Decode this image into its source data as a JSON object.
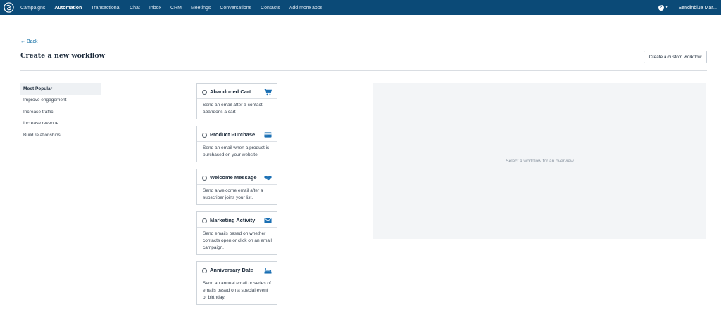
{
  "nav": {
    "items": [
      {
        "label": "Campaigns",
        "active": false
      },
      {
        "label": "Automation",
        "active": true
      },
      {
        "label": "Transactional",
        "active": false
      },
      {
        "label": "Chat",
        "active": false
      },
      {
        "label": "Inbox",
        "active": false
      },
      {
        "label": "CRM",
        "active": false
      },
      {
        "label": "Meetings",
        "active": false
      },
      {
        "label": "Conversations",
        "active": false
      },
      {
        "label": "Contacts",
        "active": false
      },
      {
        "label": "Add more apps",
        "active": false
      }
    ],
    "account_label": "Sendinblue Mar...",
    "help_icon": "question-circle-icon"
  },
  "header": {
    "back_label": "← Back",
    "title": "Create a new workflow",
    "custom_button_label": "Create a custom workflow"
  },
  "categories": [
    {
      "label": "Most Popular",
      "active": true
    },
    {
      "label": "Improve engagement",
      "active": false
    },
    {
      "label": "Increase traffic",
      "active": false
    },
    {
      "label": "Increase revenue",
      "active": false
    },
    {
      "label": "Build relationships",
      "active": false
    }
  ],
  "workflows": [
    {
      "title": "Abandoned Cart",
      "description": "Send an email after a contact abandons a cart",
      "icon": "shopping-cart-icon"
    },
    {
      "title": "Product Purchase",
      "description": "Send an email when a product is purchased on your website.",
      "icon": "credit-card-icon"
    },
    {
      "title": "Welcome Message",
      "description": "Send a welcome email after a subscriber joins your list.",
      "icon": "handshake-icon"
    },
    {
      "title": "Marketing Activity",
      "description": "Send emails based on whether contacts open or click on an email campaign.",
      "icon": "envelope-icon"
    },
    {
      "title": "Anniversary Date",
      "description": "Send an annual email or series of emails based on a special event or birthday.",
      "icon": "birthday-cake-icon"
    }
  ],
  "overview": {
    "placeholder": "Select a workflow for an overview"
  },
  "colors": {
    "nav_bg": "#0b4a77",
    "accent": "#0b6aa2",
    "icon": "#1a6fb3"
  }
}
